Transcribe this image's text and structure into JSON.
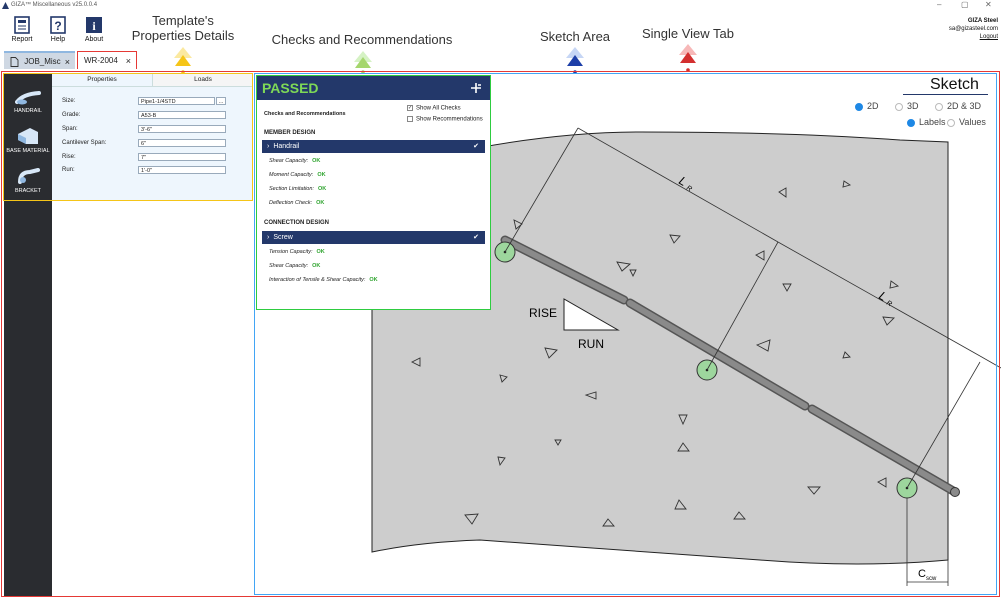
{
  "window": {
    "title": "GIZA™ Miscellaneous v25.0.0.4",
    "min": "–",
    "restore": "▢",
    "close": "✕"
  },
  "toolbar": {
    "report": "Report",
    "help": "Help",
    "about": "About"
  },
  "user": {
    "name": "GIZA Steel",
    "email": "sa@gizasteel.com",
    "logout": "Logout"
  },
  "callouts": {
    "template": "Template's\nProperties Details",
    "checks": "Checks and Recommendations",
    "sketch_area": "Sketch Area",
    "single_view": "Single View Tab"
  },
  "tabs": [
    {
      "label": "JOB_Misc",
      "close": "×"
    },
    {
      "label": "WR-2004",
      "close": "×"
    }
  ],
  "leftbar": {
    "items": [
      {
        "label": "HANDRAIL"
      },
      {
        "label": "BASE MATERIAL"
      },
      {
        "label": "BRACKET"
      }
    ]
  },
  "props": {
    "tabs": [
      "Properties",
      "Loads"
    ],
    "rows": [
      {
        "label": "Size:",
        "value": "Pipe1-1/4STD"
      },
      {
        "label": "Grade:",
        "value": "A53-B"
      },
      {
        "label": "Span:",
        "value": "3'-6\""
      },
      {
        "label": "Cantilever Span:",
        "value": "6\""
      },
      {
        "label": "Rise:",
        "value": "7\""
      },
      {
        "label": "Run:",
        "value": "1'-0\""
      }
    ],
    "browse": "..."
  },
  "checks": {
    "status": "PASSED",
    "heading": "Checks and Recommendations",
    "show_all": "Show All Checks",
    "show_recs": "Show Recommendations",
    "member_design": "MEMBER DESIGN",
    "handrail": "Handrail",
    "member_checks": [
      {
        "label": "Shear Capacity:",
        "result": "OK"
      },
      {
        "label": "Moment Capacity:",
        "result": "OK"
      },
      {
        "label": "Section Limitation:",
        "result": "OK"
      },
      {
        "label": "Deflection Check:",
        "result": "OK"
      }
    ],
    "connection_design": "CONNECTION DESIGN",
    "screw": "Screw",
    "connection_checks": [
      {
        "label": "Tension Capacity:",
        "result": "OK"
      },
      {
        "label": "Shear Capacity:",
        "result": "OK"
      },
      {
        "label": "Interaction of Tensile & Shear Capacity:",
        "result": "OK"
      }
    ]
  },
  "sketch": {
    "title": "Sketch",
    "view_options": [
      "2D",
      "3D",
      "2D & 3D"
    ],
    "view_selected": "2D",
    "label_options": [
      "Labels",
      "Values"
    ],
    "label_selected": "Labels",
    "rise": "RISE",
    "run": "RUN",
    "lr": "L",
    "lr_sub": "R",
    "cscw": "C",
    "cscw_sub": "scw"
  },
  "colors": {
    "red": "#e53935",
    "yellow": "#f5c518",
    "green": "#2ecc40",
    "blue": "#42a5f5",
    "navy": "#23386a",
    "ok": "#2ea42e"
  }
}
